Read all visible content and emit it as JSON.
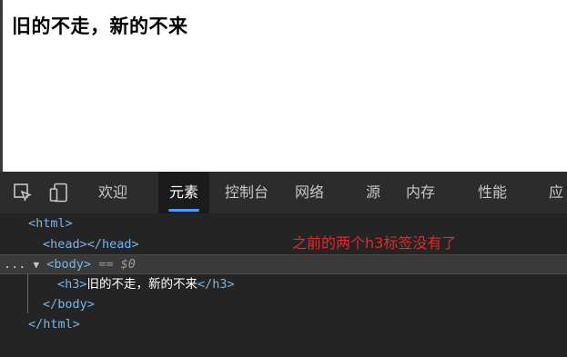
{
  "page": {
    "heading": "旧的不走，新的不来"
  },
  "devtools": {
    "tabs": [
      {
        "label": "欢迎"
      },
      {
        "label": "元素"
      },
      {
        "label": "控制台"
      },
      {
        "label": "网络"
      },
      {
        "label": "源"
      },
      {
        "label": "内存"
      },
      {
        "label": "性能"
      },
      {
        "label": "应"
      }
    ],
    "dom": {
      "html_open": "<html>",
      "head": "<head></head>",
      "dots": "...",
      "arrow": "▼",
      "body_open": "<body>",
      "selected_marker": "== $0",
      "h3_open": "<h3>",
      "h3_text": "旧的不走，新的不来",
      "h3_close": "</h3>",
      "body_close": "</body>",
      "html_close": "</html>"
    },
    "annotation": "之前的两个h3标签没有了"
  },
  "colors": {
    "annotation": "#e8262b",
    "accent": "#4a9eff",
    "tag": "#7ab5e8"
  }
}
